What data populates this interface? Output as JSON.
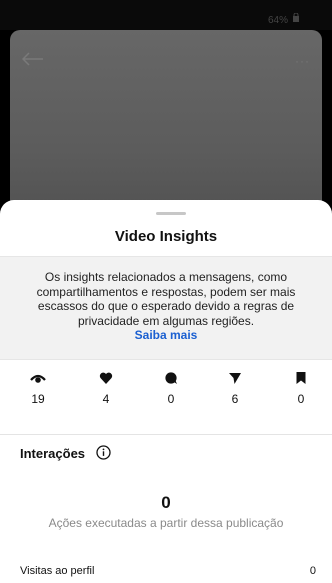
{
  "status_bar": {
    "battery": "64%"
  },
  "sheet": {
    "title": "Video Insights",
    "notice": {
      "text": "Os insights relacionados a mensagens, como compartilhamentos e respostas, podem ser mais escassos do que o esperado devido a regras de privacidade em algumas regiões.",
      "link": "Saiba mais"
    },
    "stats": [
      {
        "icon": "views-icon",
        "value": "19"
      },
      {
        "icon": "heart-icon",
        "value": "4"
      },
      {
        "icon": "comment-icon",
        "value": "0"
      },
      {
        "icon": "send-icon",
        "value": "6"
      },
      {
        "icon": "bookmark-icon",
        "value": "0"
      }
    ],
    "interactions": {
      "heading": "Interações",
      "total": "0",
      "caption": "Ações executadas a partir dessa publicação"
    },
    "rows": [
      {
        "label": "Visitas ao perfil",
        "value": "0"
      }
    ]
  }
}
